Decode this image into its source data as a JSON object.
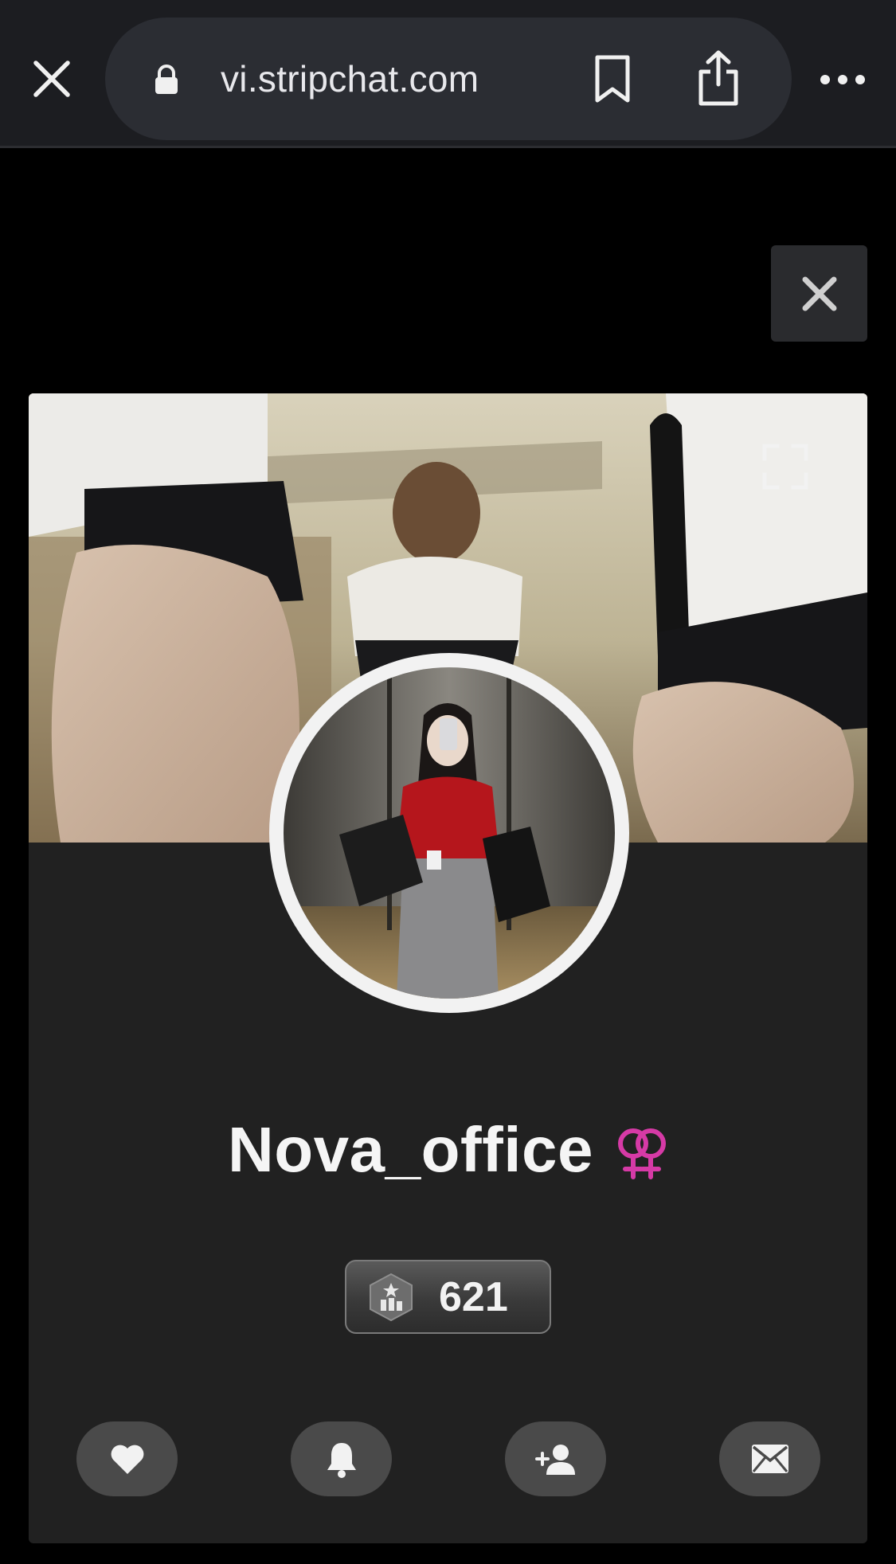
{
  "browser": {
    "url": "vi.stripchat.com",
    "icons": [
      "close-icon",
      "lock-icon",
      "bookmark-icon",
      "share-icon",
      "more-icon"
    ]
  },
  "modal": {
    "close_icon": "close-icon"
  },
  "profile": {
    "username": "Nova_office",
    "gender_icon": "female-couple-icon",
    "level": "621",
    "level_icon": "level-hexagon-icon",
    "actions": [
      "heart-icon",
      "bell-icon",
      "add-user-icon",
      "envelope-icon"
    ]
  },
  "colors": {
    "accent_gender": "#d63aa6",
    "card_background": "#212121",
    "action_button": "#4a4a4a",
    "browser_bar": "#1c1d21"
  }
}
